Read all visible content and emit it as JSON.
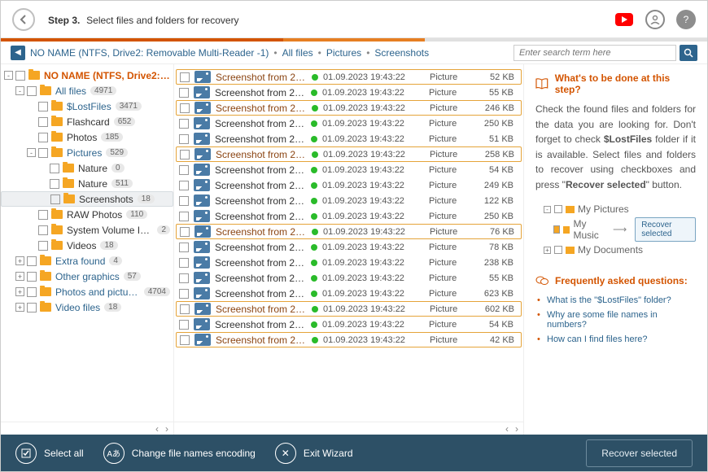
{
  "header": {
    "step_label": "Step 3.",
    "title": "Select files and folders for recovery"
  },
  "breadcrumb": {
    "root": "NO NAME (NTFS, Drive2: Removable Multi-Reader  -1)",
    "c1": "All files",
    "c2": "Pictures",
    "c3": "Screenshots"
  },
  "search": {
    "placeholder": "Enter search term here"
  },
  "tree": [
    {
      "depth": 0,
      "toggle": "-",
      "label": "NO NAME (NTFS, Drive2: Remo…",
      "cls": "root"
    },
    {
      "depth": 1,
      "toggle": "-",
      "label": "All files",
      "badge": "4971",
      "cls": "lnk"
    },
    {
      "depth": 2,
      "label": "$LostFiles",
      "badge": "3471",
      "cls": "lnk"
    },
    {
      "depth": 2,
      "label": "Flashcard",
      "badge": "652"
    },
    {
      "depth": 2,
      "label": "Photos",
      "badge": "185"
    },
    {
      "depth": 2,
      "toggle": "-",
      "label": "Pictures",
      "badge": "529",
      "cls": "lnk"
    },
    {
      "depth": 3,
      "label": "Nature",
      "badge": "0"
    },
    {
      "depth": 3,
      "label": "Nature",
      "badge": "511"
    },
    {
      "depth": 3,
      "label": "Screenshots",
      "badge": "18",
      "sel": true
    },
    {
      "depth": 2,
      "label": "RAW Photos",
      "badge": "110"
    },
    {
      "depth": 2,
      "label": "System Volume Information",
      "badge": "2"
    },
    {
      "depth": 2,
      "label": "Videos",
      "badge": "18"
    },
    {
      "depth": 1,
      "toggle": "+",
      "label": "Extra found",
      "badge": "4",
      "cls": "lnk"
    },
    {
      "depth": 1,
      "toggle": "+",
      "label": "Other graphics",
      "badge": "57",
      "cls": "lnk"
    },
    {
      "depth": 1,
      "toggle": "+",
      "label": "Photos and pictures",
      "badge": "4704",
      "cls": "lnk"
    },
    {
      "depth": 1,
      "toggle": "+",
      "label": "Video files",
      "badge": "18",
      "cls": "lnk"
    }
  ],
  "files": [
    {
      "name": "Screenshot from 20…",
      "date": "01.09.2023 19:43:22",
      "type": "Picture",
      "size": "52 KB",
      "hl": true
    },
    {
      "name": "Screenshot from 20…",
      "date": "01.09.2023 19:43:22",
      "type": "Picture",
      "size": "55 KB"
    },
    {
      "name": "Screenshot from 20…",
      "date": "01.09.2023 19:43:22",
      "type": "Picture",
      "size": "246 KB",
      "hl": true
    },
    {
      "name": "Screenshot from 20…",
      "date": "01.09.2023 19:43:22",
      "type": "Picture",
      "size": "250 KB"
    },
    {
      "name": "Screenshot from 20…",
      "date": "01.09.2023 19:43:22",
      "type": "Picture",
      "size": "51 KB"
    },
    {
      "name": "Screenshot from 20…",
      "date": "01.09.2023 19:43:22",
      "type": "Picture",
      "size": "258 KB",
      "hl": true
    },
    {
      "name": "Screenshot from 20…",
      "date": "01.09.2023 19:43:22",
      "type": "Picture",
      "size": "54 KB"
    },
    {
      "name": "Screenshot from 20…",
      "date": "01.09.2023 19:43:22",
      "type": "Picture",
      "size": "249 KB"
    },
    {
      "name": "Screenshot from 20…",
      "date": "01.09.2023 19:43:22",
      "type": "Picture",
      "size": "122 KB"
    },
    {
      "name": "Screenshot from 20…",
      "date": "01.09.2023 19:43:22",
      "type": "Picture",
      "size": "250 KB"
    },
    {
      "name": "Screenshot from 20…",
      "date": "01.09.2023 19:43:22",
      "type": "Picture",
      "size": "76 KB",
      "hl": true
    },
    {
      "name": "Screenshot from 20…",
      "date": "01.09.2023 19:43:22",
      "type": "Picture",
      "size": "78 KB"
    },
    {
      "name": "Screenshot from 20…",
      "date": "01.09.2023 19:43:22",
      "type": "Picture",
      "size": "238 KB"
    },
    {
      "name": "Screenshot from 20…",
      "date": "01.09.2023 19:43:22",
      "type": "Picture",
      "size": "55 KB"
    },
    {
      "name": "Screenshot from 20…",
      "date": "01.09.2023 19:43:22",
      "type": "Picture",
      "size": "623 KB"
    },
    {
      "name": "Screenshot from 20…",
      "date": "01.09.2023 19:43:22",
      "type": "Picture",
      "size": "602 KB",
      "hl": true
    },
    {
      "name": "Screenshot from 20…",
      "date": "01.09.2023 19:43:22",
      "type": "Picture",
      "size": "54 KB"
    },
    {
      "name": "Screenshot from 20…",
      "date": "01.09.2023 19:43:22",
      "type": "Picture",
      "size": "42 KB",
      "hl": true
    }
  ],
  "help": {
    "title": "What's to be done at this step?",
    "text1": "Check the found files and folders for the data you are looking for. Don't forget to check ",
    "bold1": "$LostFiles",
    "text2": " folder if it is available. Select files and folders to recover using checkboxes and press \"",
    "bold2": "Recover selected",
    "text3": "\" button.",
    "d1": "My Pictures",
    "d2": "My Music",
    "d3": "My Documents",
    "dbtn": "Recover selected",
    "faq_title": "Frequently asked questions:",
    "faq": [
      "What is the \"$LostFiles\" folder?",
      "Why are some file names in numbers?",
      "How can I find files here?"
    ]
  },
  "footer": {
    "select_all": "Select all",
    "encoding": "Change file names encoding",
    "exit": "Exit Wizard",
    "recover": "Recover selected"
  }
}
